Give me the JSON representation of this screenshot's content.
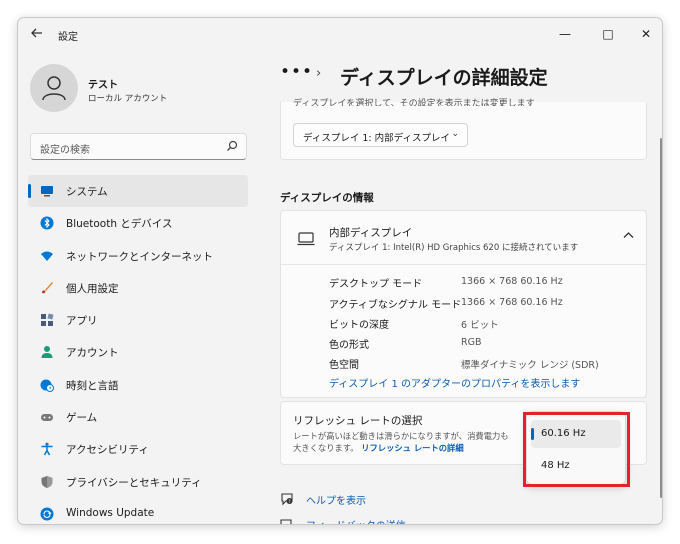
{
  "window": {
    "title": "設定",
    "controls": {
      "minimize": "—",
      "maximize": "□",
      "close": "✕"
    }
  },
  "user": {
    "name": "テスト",
    "account": "ローカル アカウント"
  },
  "search": {
    "placeholder": "設定の検索"
  },
  "sidebar": {
    "items": [
      {
        "label": "システム",
        "icon": "monitor-icon",
        "color": "#0067c0"
      },
      {
        "label": "Bluetooth とデバイス",
        "icon": "bluetooth-icon",
        "color": "#0078d4"
      },
      {
        "label": "ネットワークとインターネット",
        "icon": "wifi-icon",
        "color": "#0078d4"
      },
      {
        "label": "個人用設定",
        "icon": "brush-icon",
        "color": "#e08a22"
      },
      {
        "label": "アプリ",
        "icon": "apps-icon",
        "color": "#4a5a7a"
      },
      {
        "label": "アカウント",
        "icon": "person-icon",
        "color": "#1a9c7a"
      },
      {
        "label": "時刻と言語",
        "icon": "globe-clock-icon",
        "color": "#0078d4"
      },
      {
        "label": "ゲーム",
        "icon": "gamepad-icon",
        "color": "#777777"
      },
      {
        "label": "アクセシビリティ",
        "icon": "accessibility-icon",
        "color": "#0078d4"
      },
      {
        "label": "プライバシーとセキュリティ",
        "icon": "shield-icon",
        "color": "#777777"
      },
      {
        "label": "Windows Update",
        "icon": "update-icon",
        "color": "#0078d4"
      }
    ]
  },
  "breadcrumb": {
    "dots": "•••",
    "separator": "›",
    "title": "ディスプレイの詳細設定"
  },
  "display_select": {
    "clipped_text": "ディスプレイを選択して、その設定を表示または変更します",
    "value": "ディスプレイ 1: 内部ディスプレイ"
  },
  "info": {
    "section_title": "ディスプレイの情報",
    "title": "内部ディスプレイ",
    "subtitle": "ディスプレイ 1: Intel(R) HD Graphics 620 に接続されています",
    "rows": [
      {
        "label": "デスクトップ モード",
        "value": "1366 × 768 60.16 Hz"
      },
      {
        "label": "アクティブなシグナル モード",
        "value": "1366 × 768 60.16 Hz"
      },
      {
        "label": "ビットの深度",
        "value": "6 ビット"
      },
      {
        "label": "色の形式",
        "value": "RGB"
      },
      {
        "label": "色空間",
        "value": "標準ダイナミック レンジ (SDR)"
      }
    ],
    "adapter_link": "ディスプレイ 1 のアダプターのプロパティを表示します"
  },
  "refresh": {
    "title": "リフレッシュ レートの選択",
    "desc_line1": "レートが高いほど動きは滑らかになりますが、消費電力も",
    "desc_line2": "大きくなります。",
    "link": "リフレッシュ レートの詳細",
    "options": [
      {
        "label": "60.16 Hz",
        "selected": true
      },
      {
        "label": "48 Hz",
        "selected": false
      }
    ]
  },
  "help": {
    "get_help": "ヘルプを表示",
    "feedback": "フィードバックの送信"
  },
  "colors": {
    "accent": "#0067c0",
    "link": "#0a5bb5",
    "highlight": "#e3222a"
  }
}
